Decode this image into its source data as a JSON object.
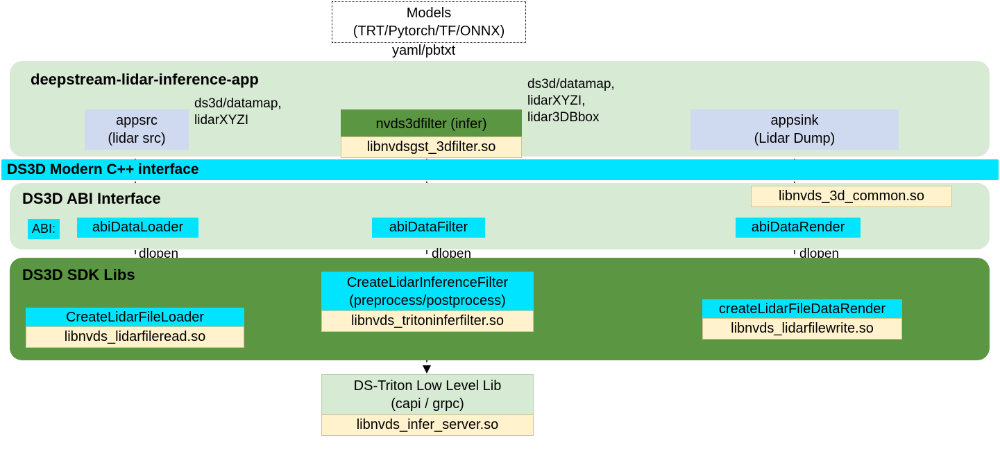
{
  "models": {
    "line1": "Models",
    "line2": "(TRT/Pytorch/TF/ONNX)",
    "yaml": "yaml/pbtxt"
  },
  "app": {
    "title": "deepstream-lidar-inference-app",
    "appsrc": {
      "line1": "appsrc",
      "line2": "(lidar src)"
    },
    "flow1": "ds3d/datamap,\nlidarXYZI",
    "filter": {
      "line1": "nvds3dfilter (infer)",
      "lib": "libnvdsgst_3dfilter.so"
    },
    "flow2": "ds3d/datamap,\nlidarXYZI,\nlidar3DBbox",
    "appsink": {
      "line1": "appsink",
      "line2": "(Lidar Dump)"
    }
  },
  "iface": {
    "bar": "DS3D Modern C++ interface",
    "title": "DS3D ABI  Interface",
    "common_lib": "libnvds_3d_common.so",
    "abi_label": "ABI:",
    "loader": "abiDataLoader",
    "filter": "abiDataFilter",
    "render": "abiDataRender",
    "dlopen": "dlopen"
  },
  "sdk": {
    "title": "DS3D SDK Libs",
    "loader_fn": "CreateLidarFileLoader",
    "loader_lib": "libnvds_lidarfileread.so",
    "filter_fn1": "CreateLidarInferenceFilter",
    "filter_fn2": "(preprocess/postprocess)",
    "filter_lib": "libnvds_tritoninferfilter.so",
    "render_fn": "createLidarFileDataRender",
    "render_lib": "libnvds_lidarfilewrite.so"
  },
  "triton": {
    "line1": "DS-Triton Low Level Lib",
    "line2": "(capi / grpc)",
    "lib": "libnvds_infer_server.so"
  }
}
